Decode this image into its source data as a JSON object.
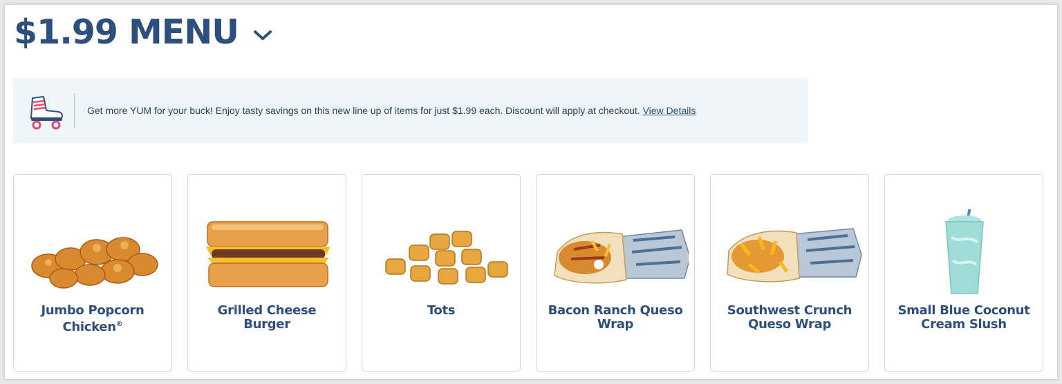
{
  "header": {
    "title": "$1.99 MENU",
    "chevron_icon": "chevron-down-icon"
  },
  "banner": {
    "icon": "roller-skate-icon",
    "text": "Get more YUM for your buck! Enjoy tasty savings on this new line up of items for just $1.99 each. Discount will apply at checkout. ",
    "link_label": "View Details"
  },
  "items": [
    {
      "name": "Jumbo Popcorn Chicken",
      "mark": "®",
      "image": "popcorn-chicken-image"
    },
    {
      "name": "Grilled Cheese Burger",
      "image": "grilled-cheese-burger-image"
    },
    {
      "name": "Tots",
      "image": "tots-image"
    },
    {
      "name": "Bacon Ranch Queso Wrap",
      "image": "bacon-ranch-queso-wrap-image"
    },
    {
      "name": "Southwest Crunch Queso Wrap",
      "image": "southwest-crunch-queso-wrap-image"
    },
    {
      "name": "Small Blue Coconut Cream Slush",
      "image": "blue-coconut-slush-image"
    }
  ],
  "colors": {
    "brand_blue": "#2d4f7d",
    "banner_bg": "#edf5f8"
  }
}
